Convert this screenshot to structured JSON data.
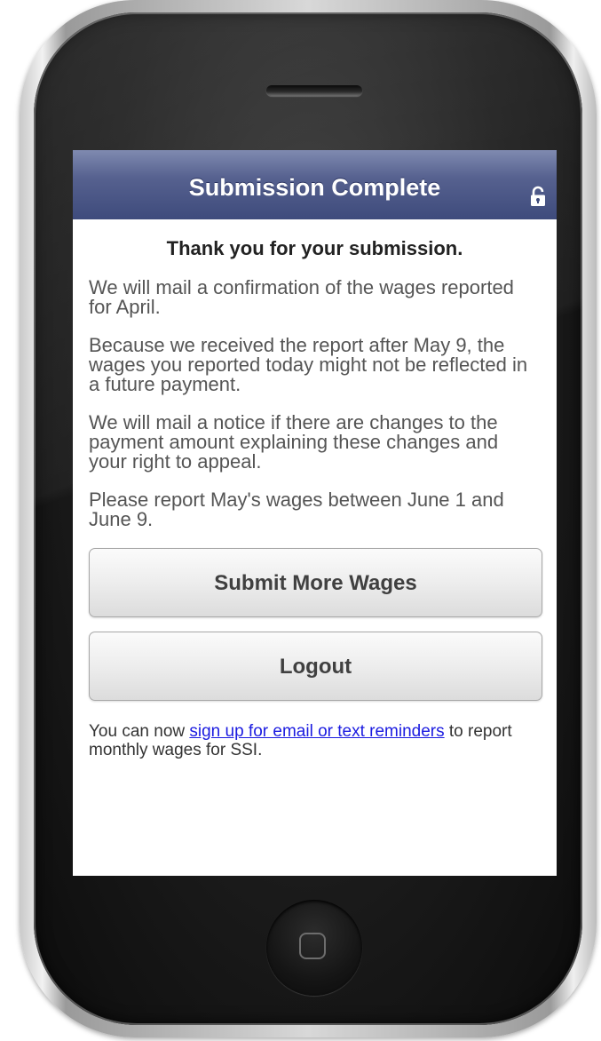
{
  "header": {
    "title": "Submission Complete",
    "lock_icon": "lock-icon"
  },
  "content": {
    "thanks": "Thank you for your submission.",
    "paragraphs": [
      "We will mail a confirmation of the wages reported for April.",
      "Because we received the report after May 9, the wages you reported today might not be reflected in a future payment.",
      "We will mail a notice if there are changes to the payment amount explaining these changes and your right to appeal.",
      "Please report May's wages between June 1 and June 9."
    ]
  },
  "buttons": {
    "submit_more": "Submit More Wages",
    "logout": "Logout"
  },
  "footer": {
    "prefix": "You can now ",
    "link": "sign up for email or text reminders",
    "suffix": " to report monthly wages for SSI."
  },
  "colors": {
    "header": "#3e4b7c",
    "link": "#1b1be0"
  }
}
